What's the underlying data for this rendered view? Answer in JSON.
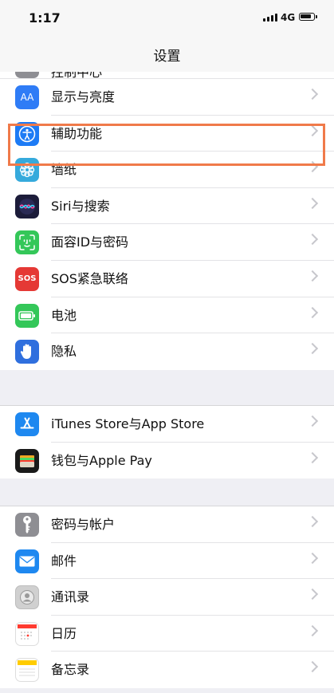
{
  "status": {
    "time": "1:17",
    "network": "4G"
  },
  "nav": {
    "title": "设置"
  },
  "groups": [
    {
      "items": [
        {
          "label": "控制中心",
          "icon": "control-center-icon",
          "color": "#8e8e93",
          "partial": true
        },
        {
          "label": "显示与亮度",
          "icon": "display-brightness-icon",
          "color": "#2f7cf6",
          "glyph": "AA"
        },
        {
          "label": "辅助功能",
          "icon": "accessibility-icon",
          "color": "#1d7bf5",
          "highlighted": true
        },
        {
          "label": "墙纸",
          "icon": "wallpaper-icon",
          "color": "#36aadc"
        },
        {
          "label": "Siri与搜索",
          "icon": "siri-icon",
          "color": "#1c1c3a"
        },
        {
          "label": "面容ID与密码",
          "icon": "face-id-icon",
          "color": "#34c759"
        },
        {
          "label": "SOS紧急联络",
          "icon": "sos-icon",
          "color": "#e53935",
          "glyph": "SOS"
        },
        {
          "label": "电池",
          "icon": "battery-icon",
          "color": "#34c759"
        },
        {
          "label": "隐私",
          "icon": "privacy-hand-icon",
          "color": "#2f6fde"
        }
      ]
    },
    {
      "items": [
        {
          "label": "iTunes Store与App Store",
          "icon": "app-store-icon",
          "color": "#1e88f0"
        },
        {
          "label": "钱包与Apple Pay",
          "icon": "wallet-icon",
          "color": "#1a1a1a"
        }
      ]
    },
    {
      "items": [
        {
          "label": "密码与帐户",
          "icon": "key-icon",
          "color": "#8e8e93"
        },
        {
          "label": "邮件",
          "icon": "mail-icon",
          "color": "#1e88f0"
        },
        {
          "label": "通讯录",
          "icon": "contacts-icon",
          "color": "#c9c9c9"
        },
        {
          "label": "日历",
          "icon": "calendar-icon",
          "color": "#ffffff"
        },
        {
          "label": "备忘录",
          "icon": "notes-icon",
          "color": "#ffffff"
        }
      ]
    }
  ]
}
